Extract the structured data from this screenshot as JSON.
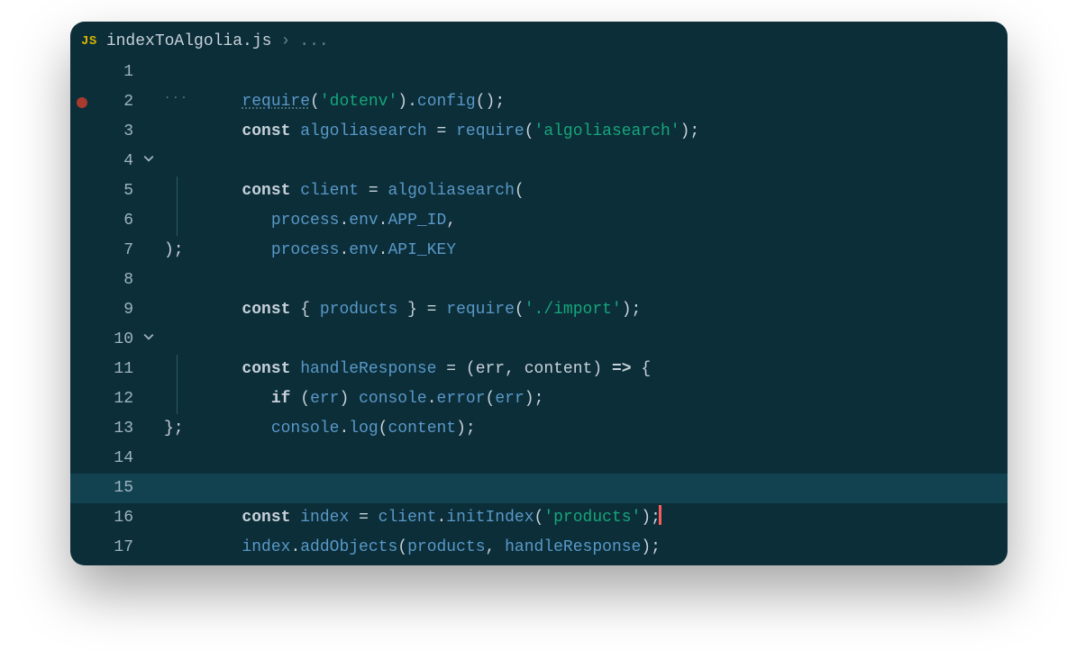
{
  "breadcrumb": {
    "badge": "JS",
    "filename": "indexToAlgolia.js",
    "sep": "›",
    "ellipsis": "..."
  },
  "editor": {
    "line_count": 17,
    "breakpoint_line": 2,
    "highlighted_line": 15,
    "fold_lines": [
      4,
      10
    ],
    "tokens": {
      "require": "require",
      "const": "const",
      "if": "if",
      "dotenv": "'dotenv'",
      "config": "config",
      "algoliasearch_v": "algoliasearch",
      "algoliasearch_s": "'algoliasearch'",
      "client": "client",
      "process": "process",
      "env": "env",
      "APP_ID": "APP_ID",
      "API_KEY": "API_KEY",
      "products": "products",
      "import_path": "'./import'",
      "handleResponse": "handleResponse",
      "err": "err",
      "content": "content",
      "console": "console",
      "error": "error",
      "log": "log",
      "index": "index",
      "initIndex": "initIndex",
      "products_str": "'products'",
      "addObjects": "addObjects",
      "eq": " = ",
      "dot": ".",
      "comma": ",",
      "semi": ";",
      "lparen": "(",
      "rparen": ")",
      "lbrace": "{",
      "rbrace": "}",
      "space_lbrace": " { ",
      "space_rbrace": " } ",
      "arrow": " => ",
      "rparen_lbrace": ") {",
      "rparen_semi": ");",
      "rbrace_semi": "};",
      "empty_parens_semi": "();",
      "hint_dots": "..."
    },
    "lineno": {
      "1": "1",
      "2": "2",
      "3": "3",
      "4": "4",
      "5": "5",
      "6": "6",
      "7": "7",
      "8": "8",
      "9": "9",
      "10": "10",
      "11": "11",
      "12": "12",
      "13": "13",
      "14": "14",
      "15": "15",
      "16": "16",
      "17": "17"
    }
  }
}
